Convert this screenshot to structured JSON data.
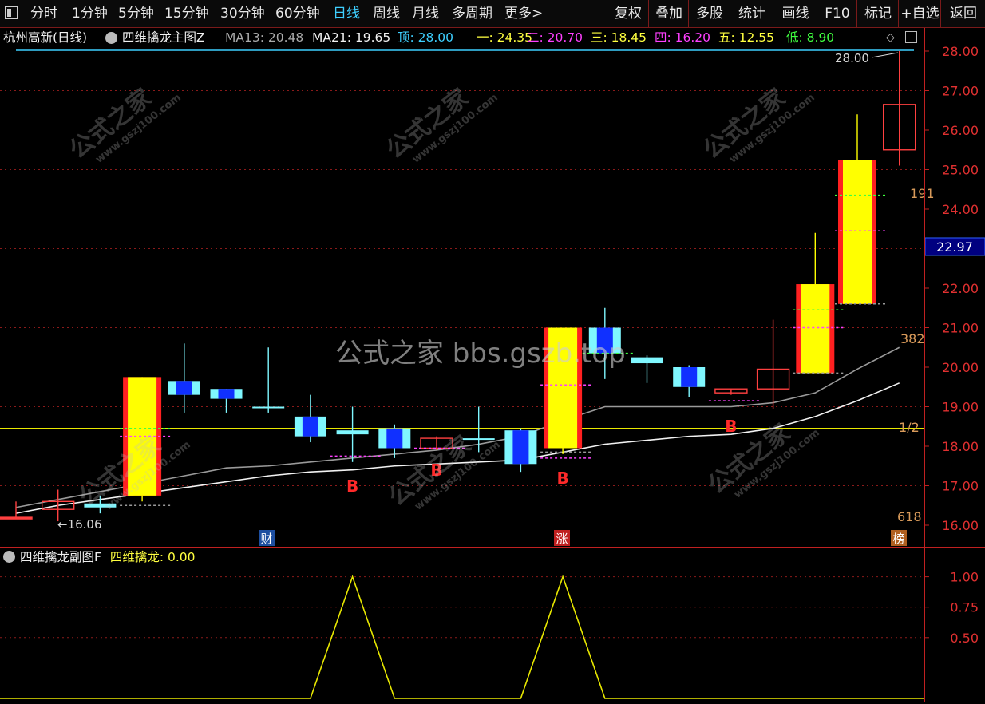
{
  "toolbar": {
    "periods": [
      "分时",
      "1分钟",
      "5分钟",
      "15分钟",
      "30分钟",
      "60分钟",
      "日线",
      "周线",
      "月线",
      "多周期",
      "更多>"
    ],
    "active_period": "日线",
    "tools": [
      "复权",
      "叠加",
      "多股",
      "统计",
      "画线",
      "F10",
      "标记",
      "+自选",
      "返回"
    ]
  },
  "header": {
    "stock": "杭州高新(日线)",
    "indicator": "四维擒龙主图Z",
    "ma13": "MA13: 20.48",
    "ma21": "MA21: 19.65",
    "levels": [
      {
        "label": "顶:",
        "value": "28.00",
        "color": "#3ecfff"
      },
      {
        "label": "一:",
        "value": "24.35",
        "color": "#ffff40"
      },
      {
        "label": "二:",
        "value": "20.70",
        "color": "#ff40ff"
      },
      {
        "label": "三:",
        "value": "18.45",
        "color": "#ffff40"
      },
      {
        "label": "四:",
        "value": "16.20",
        "color": "#ff40ff"
      },
      {
        "label": "五:",
        "value": "12.55",
        "color": "#ffff40"
      },
      {
        "label": "低:",
        "value": "8.90",
        "color": "#40ff40"
      }
    ]
  },
  "subchart": {
    "title": "四维擒龙副图F",
    "label": "四维擒龙: 0.00"
  },
  "watermark": {
    "center": "公式之家 bbs.gszb.top",
    "text": "公式之家",
    "url": "www.gszj100.com"
  },
  "chart_data": [
    {
      "type": "candlestick",
      "ylim": [
        16.0,
        28.0
      ],
      "y_ticks": [
        "16.00",
        "17.00",
        "18.00",
        "19.00",
        "20.00",
        "21.00",
        "22.00",
        "23.00",
        "24.00",
        "25.00",
        "26.00",
        "27.00",
        "28.00"
      ],
      "current_price": "22.97",
      "high_label": "28.00",
      "low_label": "←16.06",
      "fib_labels": [
        "191",
        "382",
        "1/2",
        "618"
      ],
      "horizontal_line": 18.45,
      "event_markers": [
        "财",
        "涨",
        "榜"
      ],
      "signal_labels": [
        "B",
        "B",
        "B",
        "B"
      ],
      "candles": [
        {
          "o": 16.2,
          "c": 16.2,
          "h": 16.6,
          "l": 16.2,
          "color": "#ff4040",
          "filled": true
        },
        {
          "o": 16.4,
          "c": 16.6,
          "h": 16.9,
          "l": 16.1,
          "color": "#ff4040",
          "filled": false
        },
        {
          "o": 16.45,
          "c": 16.55,
          "h": 16.75,
          "l": 16.3,
          "color": "#7ff7ff",
          "filled": true
        },
        {
          "o": 16.75,
          "c": 19.75,
          "h": 19.75,
          "l": 16.6,
          "color": "#ffff00",
          "filled": true
        },
        {
          "o": 19.3,
          "c": 19.65,
          "h": 20.6,
          "l": 18.85,
          "color": "#7ff7ff",
          "filled": true
        },
        {
          "o": 19.2,
          "c": 19.45,
          "h": 19.45,
          "l": 18.85,
          "color": "#7ff7ff",
          "filled": true
        },
        {
          "o": 19.0,
          "c": 19.0,
          "h": 20.5,
          "l": 18.85,
          "color": "#7ff7ff",
          "filled": true
        },
        {
          "o": 18.25,
          "c": 18.75,
          "h": 19.3,
          "l": 18.1,
          "color": "#7ff7ff",
          "filled": true
        },
        {
          "o": 18.3,
          "c": 18.4,
          "h": 19.0,
          "l": 17.6,
          "color": "#7ff7ff",
          "filled": true
        },
        {
          "o": 17.95,
          "c": 18.45,
          "h": 18.55,
          "l": 17.7,
          "color": "#7ff7ff",
          "filled": true
        },
        {
          "o": 17.95,
          "c": 18.2,
          "h": 18.25,
          "l": 17.9,
          "color": "#ff4040",
          "filled": false
        },
        {
          "o": 18.2,
          "c": 18.2,
          "h": 19.0,
          "l": 17.85,
          "color": "#7ff7ff",
          "filled": true
        },
        {
          "o": 17.55,
          "c": 18.4,
          "h": 18.45,
          "l": 17.35,
          "color": "#7ff7ff",
          "filled": true
        },
        {
          "o": 17.95,
          "c": 21.0,
          "h": 21.0,
          "l": 17.8,
          "color": "#ffff00",
          "filled": true
        },
        {
          "o": 20.35,
          "c": 21.0,
          "h": 21.5,
          "l": 19.7,
          "color": "#7ff7ff",
          "filled": true
        },
        {
          "o": 20.1,
          "c": 20.25,
          "h": 20.3,
          "l": 19.6,
          "color": "#7ff7ff",
          "filled": true
        },
        {
          "o": 19.5,
          "c": 20.0,
          "h": 20.05,
          "l": 19.25,
          "color": "#7ff7ff",
          "filled": true
        },
        {
          "o": 19.35,
          "c": 19.45,
          "h": 19.45,
          "l": 19.3,
          "color": "#ff4040",
          "filled": false
        },
        {
          "o": 19.45,
          "c": 19.95,
          "h": 21.2,
          "l": 18.95,
          "color": "#ff4040",
          "filled": false
        },
        {
          "o": 19.85,
          "c": 22.1,
          "h": 23.4,
          "l": 19.85,
          "color": "#ffff00",
          "filled": true
        },
        {
          "o": 21.6,
          "c": 25.25,
          "h": 26.4,
          "l": 21.6,
          "color": "#ffff00",
          "filled": true
        },
        {
          "o": 25.5,
          "c": 26.65,
          "h": 28.0,
          "l": 25.1,
          "color": "#ff4040",
          "filled": false
        }
      ],
      "ma13": [
        16.3,
        16.5,
        16.65,
        16.8,
        16.95,
        17.1,
        17.25,
        17.35,
        17.4,
        17.5,
        17.55,
        17.6,
        17.65,
        17.85,
        18.05,
        18.15,
        18.25,
        18.3,
        18.45,
        18.75,
        19.15,
        19.6
      ],
      "ma21": [
        16.45,
        16.65,
        16.85,
        17.05,
        17.25,
        17.45,
        17.5,
        17.6,
        17.7,
        17.8,
        17.9,
        18.05,
        18.25,
        18.65,
        19.0,
        19.0,
        19.0,
        19.0,
        19.1,
        19.35,
        19.95,
        20.5
      ]
    },
    {
      "type": "line",
      "ylim": [
        0,
        1.05
      ],
      "y_ticks": [
        "0.50",
        "0.75",
        "1.00"
      ],
      "series": [
        {
          "name": "四维擒龙",
          "values": [
            0,
            0,
            0,
            0,
            0,
            0,
            0,
            0,
            1,
            0,
            0,
            0,
            0,
            1,
            0,
            0,
            0,
            0,
            0,
            0,
            0,
            0
          ]
        }
      ]
    }
  ]
}
